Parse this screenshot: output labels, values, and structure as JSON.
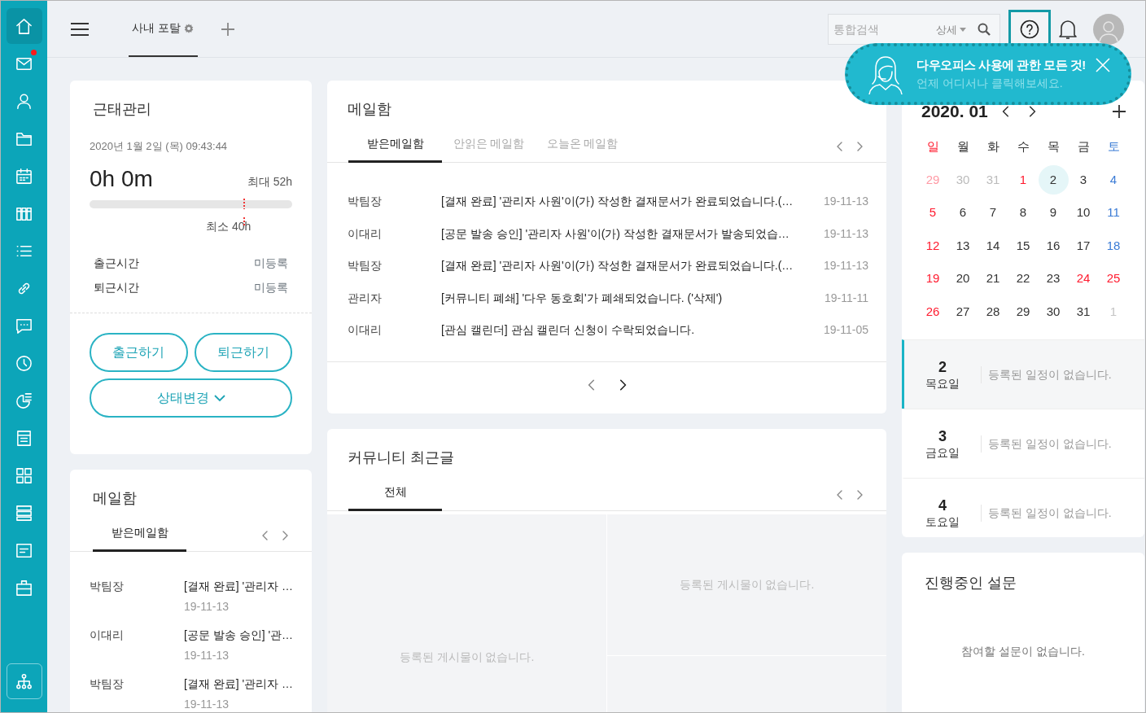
{
  "sidebar": {
    "items": [
      {
        "selected": true,
        "notification": false
      },
      {
        "selected": false,
        "notification": true
      },
      {
        "selected": false,
        "notification": false
      },
      {
        "selected": false,
        "notification": false
      },
      {
        "selected": false,
        "notification": false
      },
      {
        "selected": false,
        "notification": false
      },
      {
        "selected": false,
        "notification": false
      },
      {
        "selected": false,
        "notification": false
      },
      {
        "selected": false,
        "notification": false
      },
      {
        "selected": false,
        "notification": false
      },
      {
        "selected": false,
        "notification": false
      },
      {
        "selected": false,
        "notification": false
      },
      {
        "selected": false,
        "notification": false
      },
      {
        "selected": false,
        "notification": false
      },
      {
        "selected": false,
        "notification": false
      },
      {
        "selected": false,
        "notification": false
      }
    ]
  },
  "header": {
    "tabs": [
      {
        "label": "사내 포탈",
        "selected": true
      }
    ],
    "search": {
      "placeholder": "통합검색",
      "detail_label": "상세"
    }
  },
  "help_tip": {
    "title": "다우오피스 사용에 관한 모든 것!",
    "subtitle": "언제 어디서나 클릭해보세요."
  },
  "attendance": {
    "title": "근태관리",
    "datetime": "2020년 1월 2일 (목) 09:43:44",
    "worked": "0h 0m",
    "max_label": "최대 52h",
    "min_label": "최소 40h",
    "records": [
      {
        "label": "출근시간",
        "value": "미등록"
      },
      {
        "label": "퇴근시간",
        "value": "미등록"
      }
    ],
    "buttons": [
      "출근하기",
      "퇴근하기"
    ],
    "status_button": "상태변경"
  },
  "mail_main": {
    "title": "메일함",
    "tabs": [
      {
        "label": "받은메일함",
        "selected": true
      },
      {
        "label": "안읽은 메일함",
        "selected": false
      },
      {
        "label": "오늘온 메일함",
        "selected": false
      }
    ],
    "rows": [
      {
        "sender": "박팀장",
        "subject": "[결재 완료] '관리자 사원'이(가) 작성한 결재문서가 완료되었습니다.(…",
        "date": "19-11-13"
      },
      {
        "sender": "이대리",
        "subject": "[공문 발송 승인] '관리자 사원'이(가) 작성한 결재문서가 발송되었습…",
        "date": "19-11-13"
      },
      {
        "sender": "박팀장",
        "subject": "[결재 완료] '관리자 사원'이(가) 작성한 결재문서가 완료되었습니다.(…",
        "date": "19-11-13"
      },
      {
        "sender": "관리자",
        "subject": "[커뮤니티 폐쇄] '다우 동호회'가 폐쇄되었습니다. ('삭제')",
        "date": "19-11-11"
      },
      {
        "sender": "이대리",
        "subject": "[관심 캘린더] 관심 캘린더 신청이 수락되었습니다.",
        "date": "19-11-05"
      }
    ]
  },
  "community": {
    "title": "커뮤니티 최근글",
    "tabs": [
      {
        "label": "전체",
        "selected": true
      }
    ],
    "empty_messages": [
      "등록된 게시물이 없습니다.",
      "등록된 게시물이 없습니다."
    ]
  },
  "mail_small": {
    "title": "메일함",
    "tabs": [
      {
        "label": "받은메일함",
        "selected": true
      }
    ],
    "rows": [
      {
        "sender": "박팀장",
        "subject": "[결재 완료] '관리자 …",
        "date": "19-11-13"
      },
      {
        "sender": "이대리",
        "subject": "[공문 발송 승인] '관…",
        "date": "19-11-13"
      },
      {
        "sender": "박팀장",
        "subject": "[결재 완료] '관리자 …",
        "date": "19-11-13"
      }
    ]
  },
  "calendar": {
    "month_label": "2020. 01",
    "weekdays": [
      {
        "label": "일",
        "kind": "sunday"
      },
      {
        "label": "월",
        "kind": "weekday"
      },
      {
        "label": "화",
        "kind": "weekday"
      },
      {
        "label": "수",
        "kind": "weekday"
      },
      {
        "label": "목",
        "kind": "weekday"
      },
      {
        "label": "금",
        "kind": "weekday"
      },
      {
        "label": "토",
        "kind": "saturday"
      }
    ],
    "weeks": [
      [
        {
          "day": "29",
          "kind": "sunday",
          "outside": true,
          "selected": false
        },
        {
          "day": "30",
          "kind": "weekday",
          "outside": true,
          "selected": false
        },
        {
          "day": "31",
          "kind": "weekday",
          "outside": true,
          "selected": false
        },
        {
          "day": "1",
          "kind": "holiday",
          "outside": false,
          "selected": false
        },
        {
          "day": "2",
          "kind": "weekday",
          "outside": false,
          "selected": true
        },
        {
          "day": "3",
          "kind": "weekday",
          "outside": false,
          "selected": false
        },
        {
          "day": "4",
          "kind": "saturday",
          "outside": false,
          "selected": false
        }
      ],
      [
        {
          "day": "5",
          "kind": "sunday",
          "outside": false,
          "selected": false
        },
        {
          "day": "6",
          "kind": "weekday",
          "outside": false,
          "selected": false
        },
        {
          "day": "7",
          "kind": "weekday",
          "outside": false,
          "selected": false
        },
        {
          "day": "8",
          "kind": "weekday",
          "outside": false,
          "selected": false
        },
        {
          "day": "9",
          "kind": "weekday",
          "outside": false,
          "selected": false
        },
        {
          "day": "10",
          "kind": "weekday",
          "outside": false,
          "selected": false
        },
        {
          "day": "11",
          "kind": "saturday",
          "outside": false,
          "selected": false
        }
      ],
      [
        {
          "day": "12",
          "kind": "sunday",
          "outside": false,
          "selected": false
        },
        {
          "day": "13",
          "kind": "weekday",
          "outside": false,
          "selected": false
        },
        {
          "day": "14",
          "kind": "weekday",
          "outside": false,
          "selected": false
        },
        {
          "day": "15",
          "kind": "weekday",
          "outside": false,
          "selected": false
        },
        {
          "day": "16",
          "kind": "weekday",
          "outside": false,
          "selected": false
        },
        {
          "day": "17",
          "kind": "weekday",
          "outside": false,
          "selected": false
        },
        {
          "day": "18",
          "kind": "saturday",
          "outside": false,
          "selected": false
        }
      ],
      [
        {
          "day": "19",
          "kind": "sunday",
          "outside": false,
          "selected": false
        },
        {
          "day": "20",
          "kind": "weekday",
          "outside": false,
          "selected": false
        },
        {
          "day": "21",
          "kind": "weekday",
          "outside": false,
          "selected": false
        },
        {
          "day": "22",
          "kind": "weekday",
          "outside": false,
          "selected": false
        },
        {
          "day": "23",
          "kind": "weekday",
          "outside": false,
          "selected": false
        },
        {
          "day": "24",
          "kind": "holiday",
          "outside": false,
          "selected": false
        },
        {
          "day": "25",
          "kind": "holiday",
          "outside": false,
          "selected": false
        }
      ],
      [
        {
          "day": "26",
          "kind": "sunday",
          "outside": false,
          "selected": false
        },
        {
          "day": "27",
          "kind": "weekday",
          "outside": false,
          "selected": false
        },
        {
          "day": "28",
          "kind": "weekday",
          "outside": false,
          "selected": false
        },
        {
          "day": "29",
          "kind": "weekday",
          "outside": false,
          "selected": false
        },
        {
          "day": "30",
          "kind": "weekday",
          "outside": false,
          "selected": false
        },
        {
          "day": "31",
          "kind": "weekday",
          "outside": false,
          "selected": false
        },
        {
          "day": "1",
          "kind": "saturday",
          "outside": true,
          "selected": false
        }
      ]
    ],
    "agenda": [
      {
        "day": "2",
        "weekday": "목요일",
        "message": "등록된 일정이 없습니다.",
        "selected": true
      },
      {
        "day": "3",
        "weekday": "금요일",
        "message": "등록된 일정이 없습니다.",
        "selected": false
      },
      {
        "day": "4",
        "weekday": "토요일",
        "message": "등록된 일정이 없습니다.",
        "selected": false
      }
    ]
  },
  "survey": {
    "title": "진행중인 설문",
    "empty_message": "참여할 설문이 없습니다."
  }
}
